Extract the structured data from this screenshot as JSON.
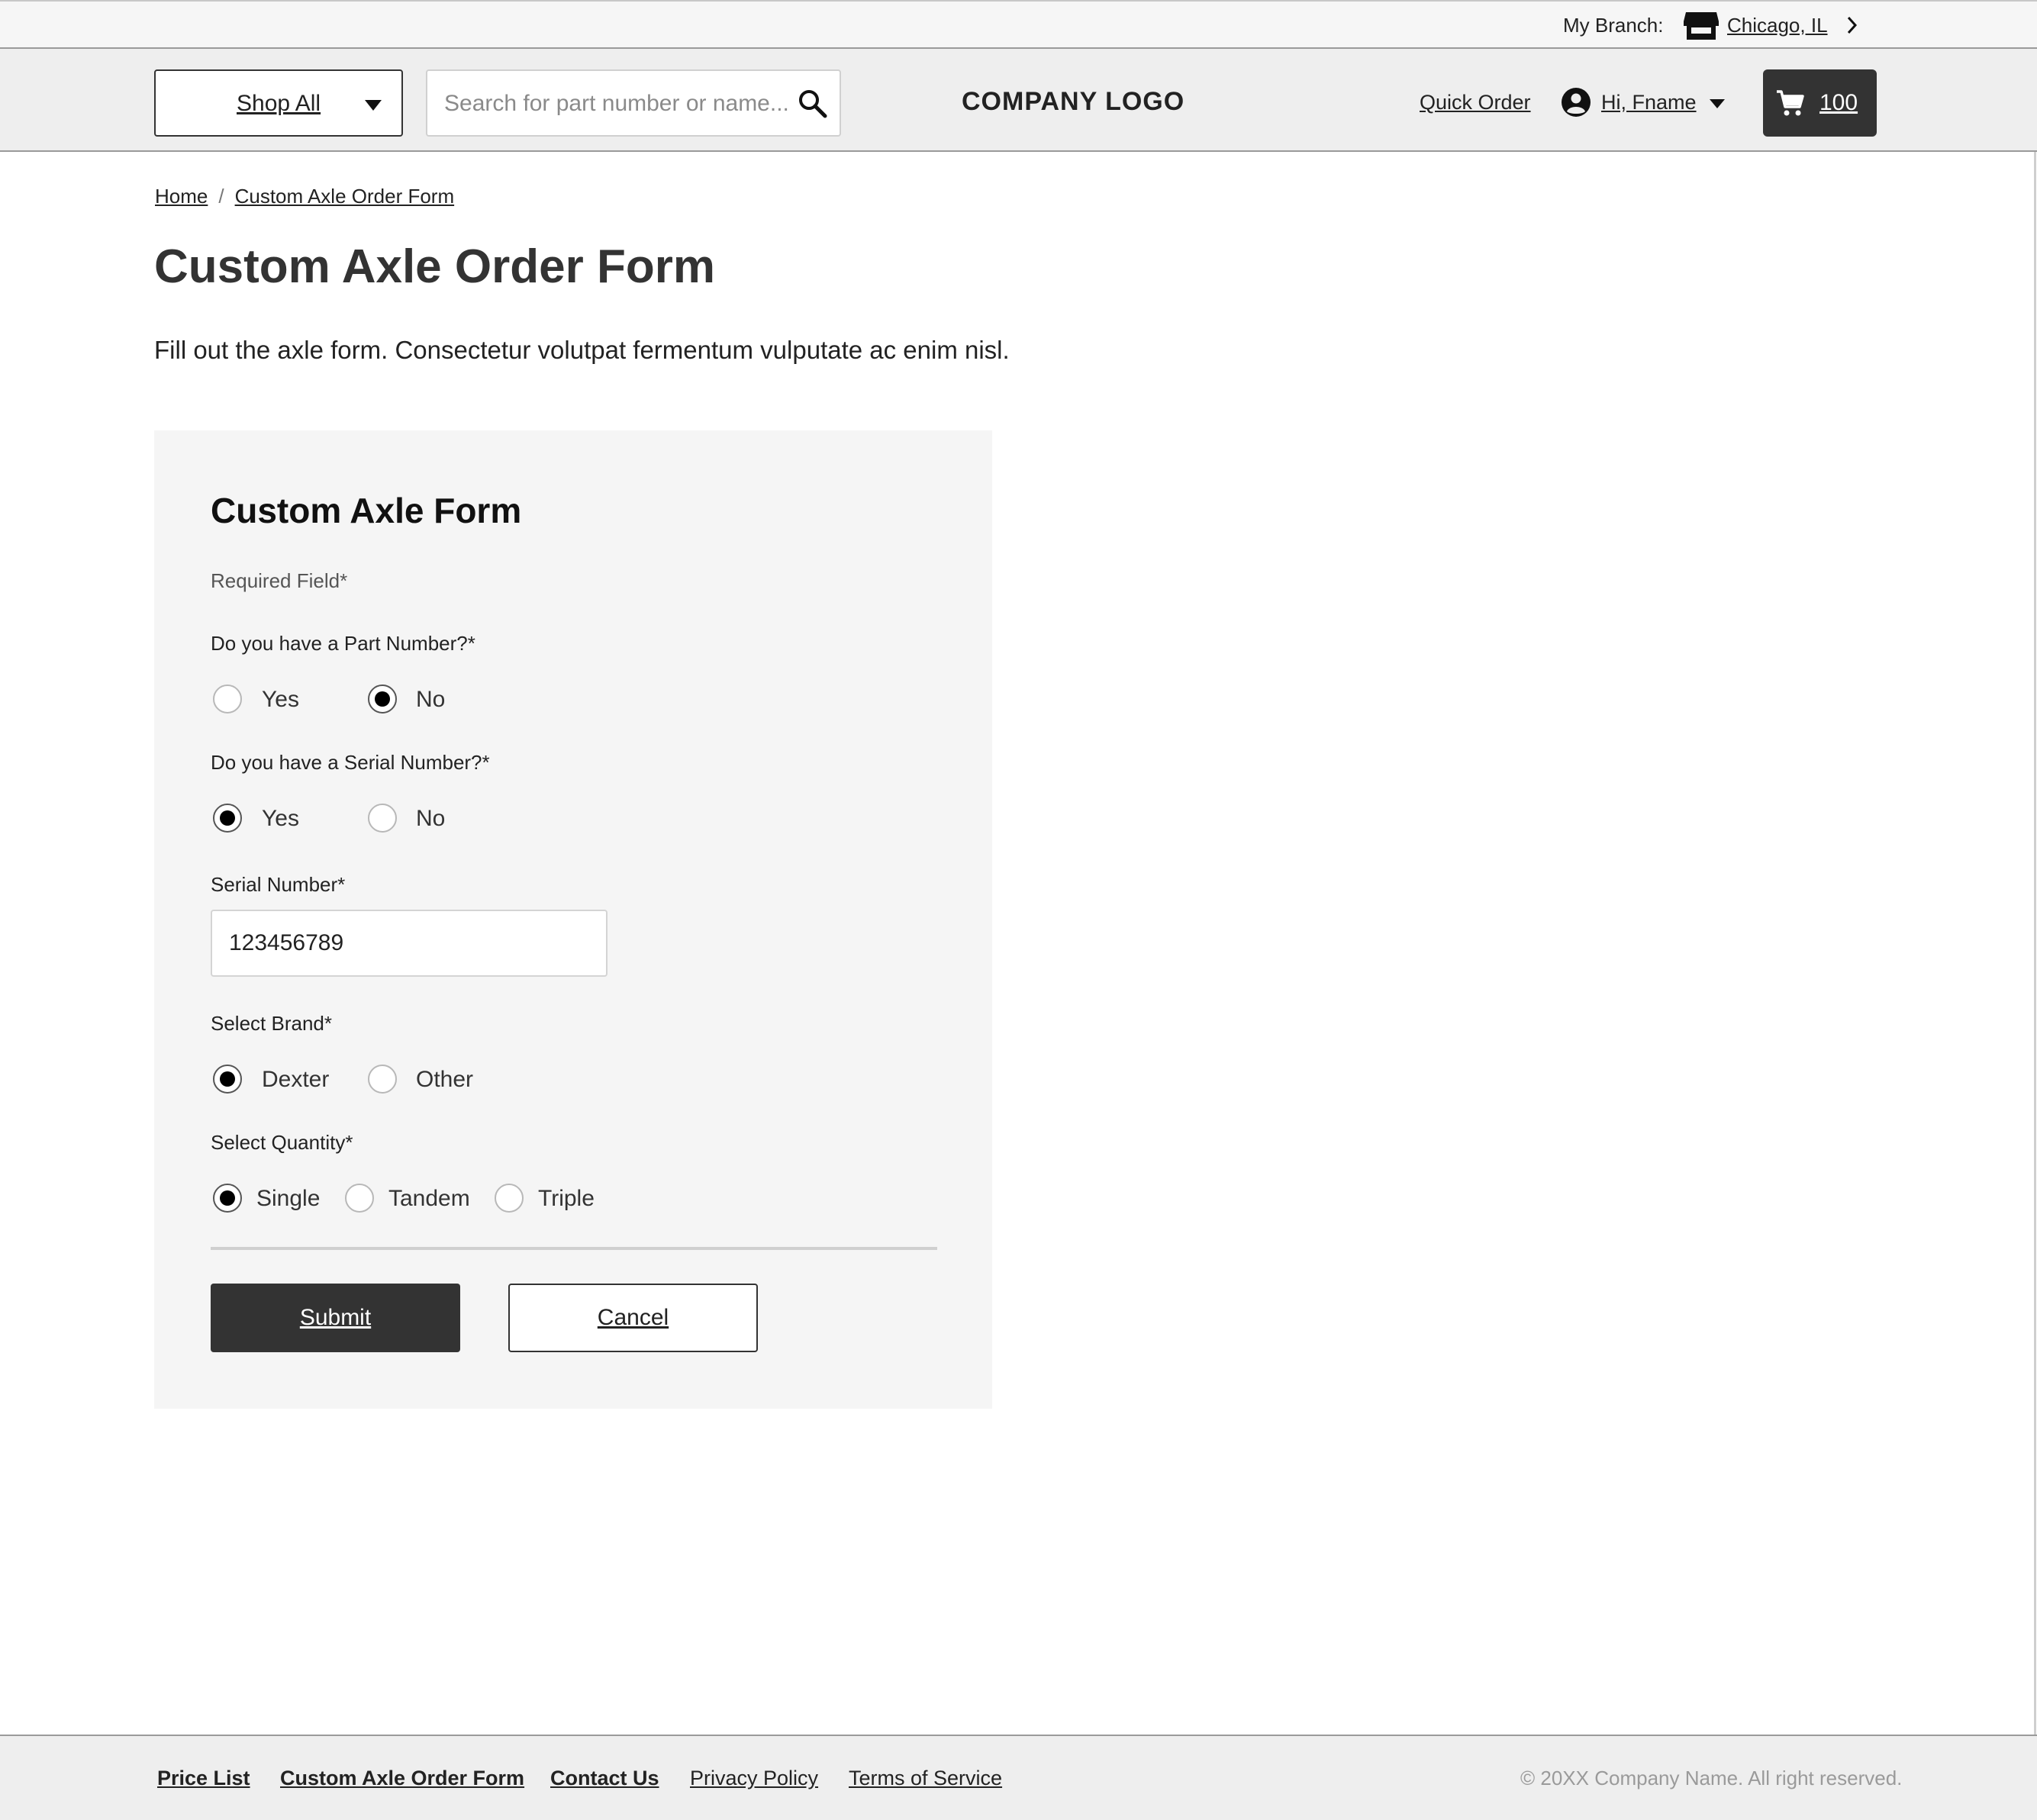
{
  "utility_bar": {
    "branch_label": "My Branch:",
    "branch_name": "Chicago, IL"
  },
  "header": {
    "shop_all_label": "Shop All",
    "search_placeholder": "Search for part number or name...",
    "logo": "COMPANY LOGO",
    "quick_order": "Quick Order",
    "greeting": "Hi, Fname",
    "cart_count": "100"
  },
  "breadcrumb": {
    "items": [
      "Home",
      "Custom Axle Order Form"
    ],
    "separator": "/"
  },
  "page": {
    "title": "Custom Axle Order Form",
    "description": "Fill out the axle form. Consectetur volutpat fermentum vulputate ac enim nisl."
  },
  "form": {
    "title": "Custom Axle Form",
    "required_note": "Required Field*",
    "part_number": {
      "label": "Do you have a Part Number?*",
      "options": [
        "Yes",
        "No"
      ],
      "selected": "No"
    },
    "serial_question": {
      "label": "Do you have a Serial Number?*",
      "options": [
        "Yes",
        "No"
      ],
      "selected": "Yes"
    },
    "serial_field": {
      "label": "Serial Number*",
      "value": "123456789"
    },
    "brand": {
      "label": "Select Brand*",
      "options": [
        "Dexter",
        "Other"
      ],
      "selected": "Dexter"
    },
    "quantity": {
      "label": "Select Quantity*",
      "options": [
        "Single",
        "Tandem",
        "Triple"
      ],
      "selected": "Single"
    },
    "submit_label": "Submit",
    "cancel_label": "Cancel"
  },
  "footer": {
    "links": [
      "Price List",
      "Custom Axle Order Form",
      "Contact Us",
      "Privacy Policy",
      "Terms of Service"
    ],
    "copyright": "© 20XX Company Name. All right reserved."
  },
  "icons": {
    "store": "store-icon",
    "chevron": "chevron-right-icon",
    "caret": "caret-down-icon",
    "search": "search-icon",
    "user": "user-circle-icon",
    "cart": "cart-icon"
  },
  "colors": {
    "dark": "#333333",
    "header_bg": "#eeeeee",
    "card_bg": "#f5f5f5"
  }
}
